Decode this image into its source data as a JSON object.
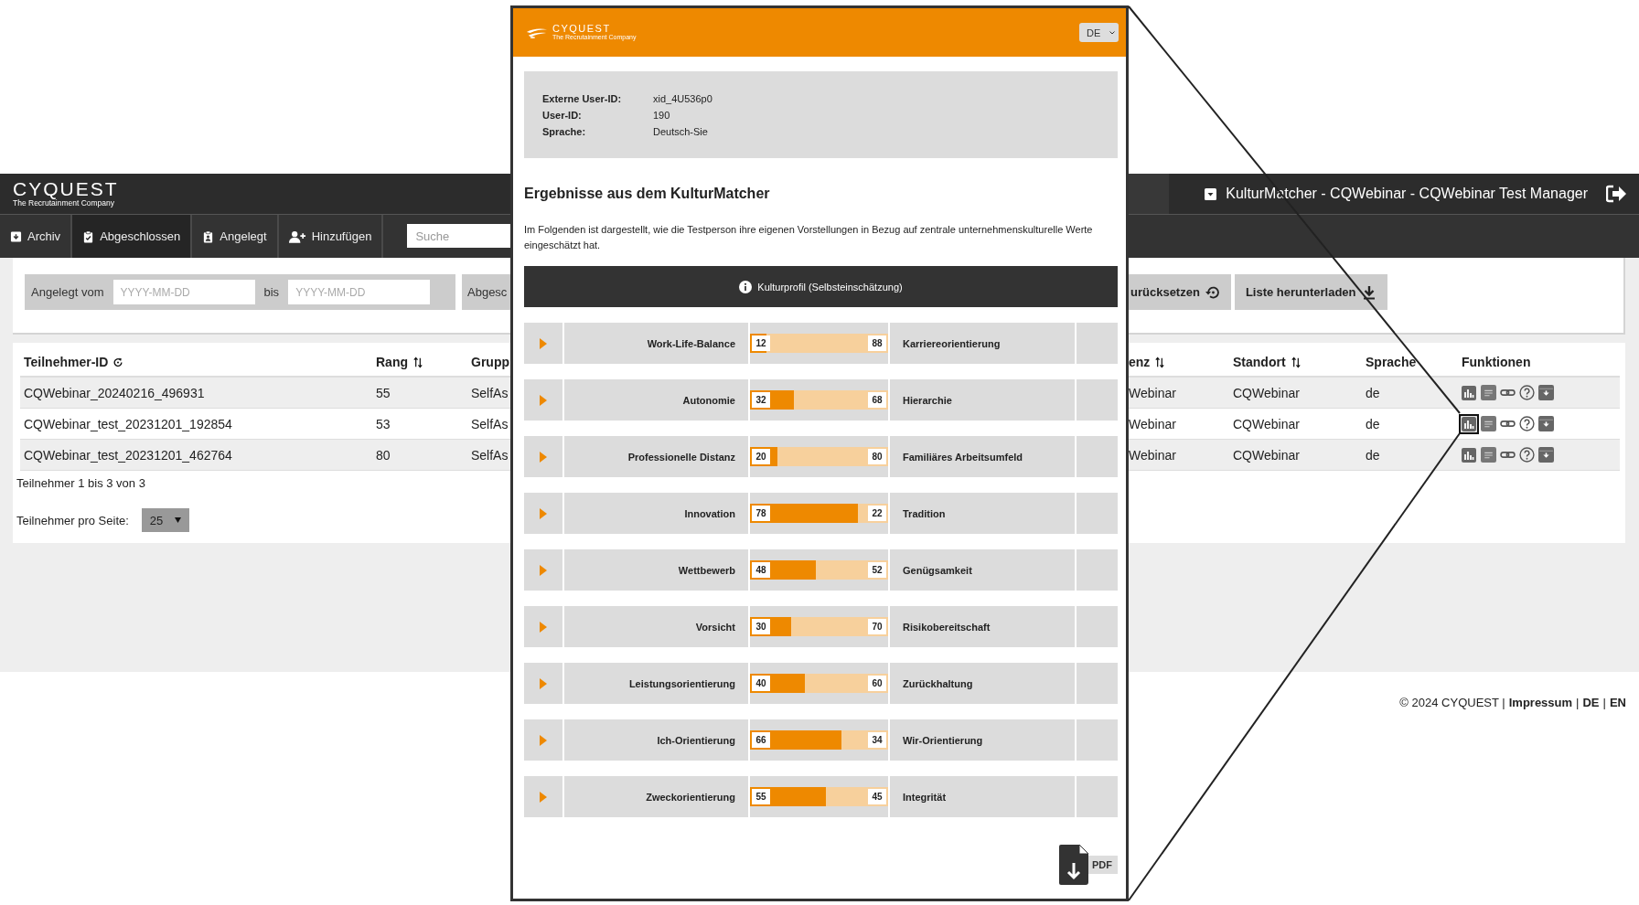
{
  "header": {
    "logo": {
      "name": "CYQUEST",
      "tagline": "The Recrutainment Company"
    },
    "title": "KulturMatcher - CQWebinar - CQWebinar Test Manager"
  },
  "nav": {
    "tabs": [
      {
        "label": "Archiv",
        "selected": false
      },
      {
        "label": "Abgeschlossen",
        "selected": true
      },
      {
        "label": "Angelegt",
        "selected": false
      },
      {
        "label": "Hinzufügen",
        "selected": false
      }
    ],
    "search": {
      "placeholder": "Suche"
    }
  },
  "filter": {
    "created_label": "Angelegt  vom",
    "from_placeholder": "YYYY-MM-DD",
    "to_label": "bis",
    "to_placeholder": "YYYY-MM-DD",
    "completed_label": "Abgesc",
    "reset_button": "urücksetzen",
    "download_button": "Liste herunterladen"
  },
  "table": {
    "columns": [
      "Teilnehmer-ID",
      "Rang",
      "Grupp",
      "enz",
      "Standort",
      "Sprache",
      "Funktionen"
    ],
    "rows": [
      {
        "cells": [
          "CQWebinar_20240216_496931",
          "55",
          "SelfAs",
          "Webinar",
          "CQWebinar",
          "de"
        ],
        "selected": false
      },
      {
        "cells": [
          "CQWebinar_test_20231201_192854",
          "53",
          "SelfAs",
          "Webinar",
          "CQWebinar",
          "de"
        ],
        "selected": true
      },
      {
        "cells": [
          "CQWebinar_test_20231201_462764",
          "80",
          "SelfAs",
          "Webinar",
          "CQWebinar",
          "de"
        ],
        "selected": false
      }
    ]
  },
  "pager": {
    "summary": "Teilnehmer 1 bis 3 von 3",
    "per_page_label": "Teilnehmer pro Seite:",
    "per_page_value": "25"
  },
  "footer": {
    "copyright": "© 2024 CYQUEST",
    "separator": "|",
    "links": [
      "Impressum",
      "DE",
      "EN"
    ]
  },
  "popup": {
    "logo": {
      "name": "CYQUEST",
      "tagline": "The Recrutainment Company"
    },
    "language": "DE",
    "info": [
      {
        "label": "Externe User-ID:",
        "value": "xid_4U536p0"
      },
      {
        "label": "User-ID:",
        "value": "190"
      },
      {
        "label": "Sprache:",
        "value": "Deutsch-Sie"
      }
    ],
    "heading": "Ergebnisse aus dem KulturMatcher",
    "intro": "Im Folgenden ist dargestellt, wie die Testperson ihre eigenen Vorstellungen in Bezug auf zentrale unternehmenskulturelle Werte eingeschätzt hat.",
    "section_title": "Kulturprofil (Selbsteinschätzung)",
    "rows": [
      {
        "left": "Work-Life-Balance",
        "left_value": "12",
        "right_value": "88",
        "right": "Karriereorientierung",
        "level": 0.12
      },
      {
        "left": "Autonomie",
        "left_value": "32",
        "right_value": "68",
        "right": "Hierarchie",
        "level": 0.32
      },
      {
        "left": "Professionelle Distanz",
        "left_value": "20",
        "right_value": "80",
        "right": "Familiäres Arbeitsumfeld",
        "level": 0.2
      },
      {
        "left": "Innovation",
        "left_value": "78",
        "right_value": "22",
        "right": "Tradition",
        "level": 0.78
      },
      {
        "left": "Wettbewerb",
        "left_value": "48",
        "right_value": "52",
        "right": "Genügsamkeit",
        "level": 0.48
      },
      {
        "left": "Vorsicht",
        "left_value": "30",
        "right_value": "70",
        "right": "Risikobereitschaft",
        "level": 0.3
      },
      {
        "left": "Leistungsorientierung",
        "left_value": "40",
        "right_value": "60",
        "right": "Zurückhaltung",
        "level": 0.4
      },
      {
        "left": "Ich-Orientierung",
        "left_value": "66",
        "right_value": "34",
        "right": "Wir-Orientierung",
        "level": 0.66
      },
      {
        "left": "Zweckorientierung",
        "left_value": "55",
        "right_value": "45",
        "right": "Integrität",
        "level": 0.55
      }
    ],
    "pdf_button": "PDF"
  }
}
